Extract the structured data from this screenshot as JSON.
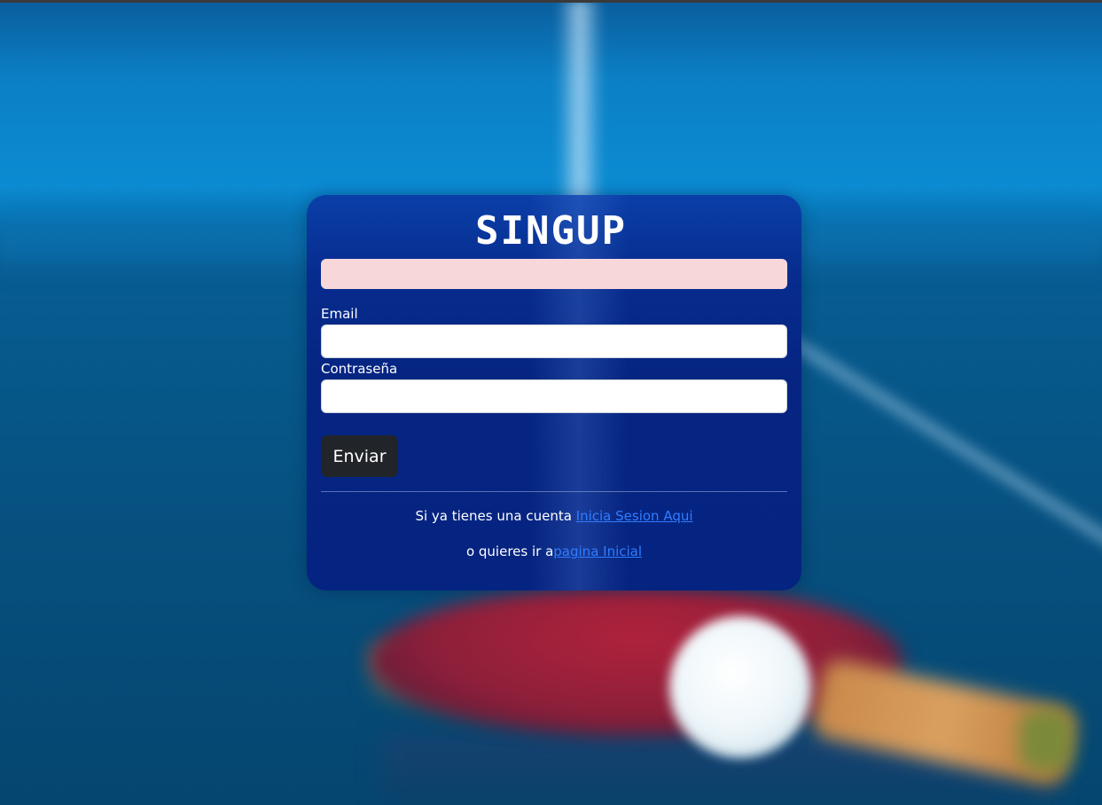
{
  "form": {
    "title": "SINGUP",
    "alert_text": "",
    "email_label": "Email",
    "email_value": "",
    "password_label": "Contraseña",
    "password_value": "",
    "submit_label": "Enviar"
  },
  "footer": {
    "login_prefix": "Si ya tienes una cuenta ",
    "login_link": "Inicia Sesion Aqui",
    "home_prefix": "o quieres ir a",
    "home_link": "pagina Inicial"
  },
  "colors": {
    "card": "#062583",
    "alert": "#f8d7da",
    "button": "#212529",
    "link": "#2f7dff"
  }
}
